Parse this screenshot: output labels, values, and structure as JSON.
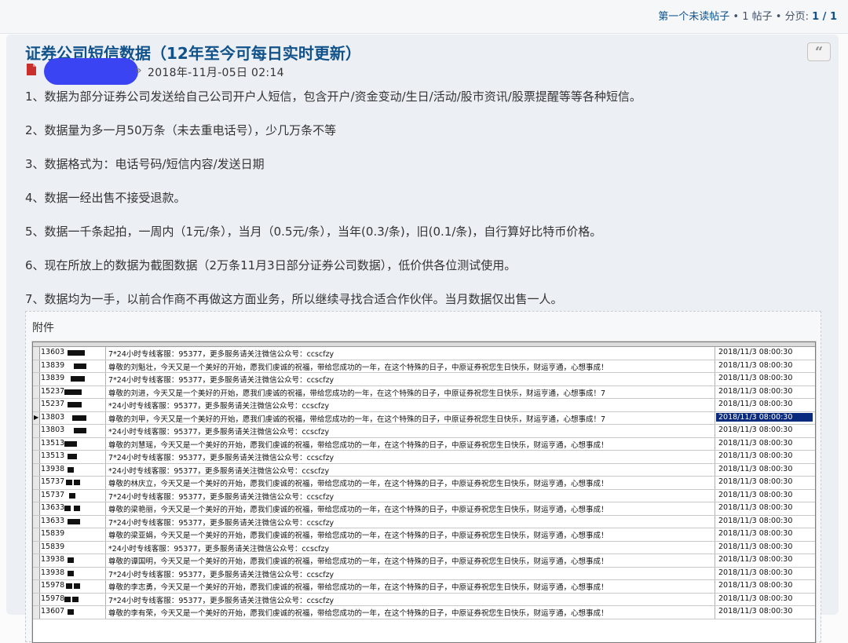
{
  "topbar": {
    "first_unread": "第一个未读帖子",
    "sep1": "•",
    "post_count": "1 帖子",
    "sep2": "•",
    "page_label": "分页:",
    "pages": "1 / 1"
  },
  "post": {
    "title": "证券公司短信数据（12年至今可每日实时更新）",
    "quote_icon": "quote-icon",
    "author_sep": "»",
    "date": "2018年-11月-05日 02:14",
    "paragraphs": [
      "1、数据为部分证券公司发送给自己公司开户人短信，包含开户/资金变动/生日/活动/股市资讯/股票提醒等等各种短信。",
      "2、数据量为多一月50万条（未去重电话号），少几万条不等",
      "3、数据格式为：电话号码/短信内容/发送日期",
      "4、数据一经出售不接受退款。",
      "5、数据一千条起拍，一周内（1元/条），当月（0.5元/条），当年(0.3/条)，旧(0.1/条)，自行算好比特币价格。",
      "6、现在所放上的数据为截图数据（2万条11月3日部分证券公司数据），低价供各位测试使用。",
      "7、数据均为一手，以前合作商不再做这方面业务，所以继续寻找合适合作伙伴。当月数据仅出售一人。"
    ]
  },
  "attachment": {
    "label": "附件",
    "rows": [
      {
        "phone": "13603",
        "sms": "7*24小时专线客服：95377，更多服务请关注微信公众号：ccscfzy",
        "date": "2018/11/3 08:00:30",
        "active": false
      },
      {
        "phone": "13839",
        "sms": "尊敬的刘魁壮，今天又是一个美好的开始，愿我们虔诚的祝福，带给您成功的一年，在这个特殊的日子，中原证券祝您生日快乐，财运亨通，心想事成！",
        "date": "2018/11/3 08:00:30",
        "active": false
      },
      {
        "phone": "13839",
        "sms": "7*24小时专线客服：95377，更多服务请关注微信公众号：ccscfzy",
        "date": "2018/11/3 08:00:30",
        "active": false
      },
      {
        "phone": "15237",
        "sms": "尊敬的刘进，今天又是一个美好的开始，愿我们虔诚的祝福，带给您成功的一年，在这个特殊的日子，中原证券祝您生日快乐，财运亨通，心想事成！7",
        "date": "2018/11/3 08:00:30",
        "active": false
      },
      {
        "phone": "15237",
        "sms": "*24小时专线客服：95377，更多服务请关注微信公众号：ccscfzy",
        "date": "2018/11/3 08:00:30",
        "active": false
      },
      {
        "phone": "13803",
        "sms": "尊敬的刘甲，今天又是一个美好的开始，愿我们虔诚的祝福，带给您成功的一年，在这个特殊的日子，中原证券祝您生日快乐，财运亨通，心想事成！7",
        "date": "2018/11/3 08:00:30",
        "active": true
      },
      {
        "phone": "13803",
        "sms": "*24小时专线客服：95377，更多服务请关注微信公众号：ccscfzy",
        "date": "2018/11/3 08:00:30",
        "active": false
      },
      {
        "phone": "13513",
        "sms": "尊敬的刘慧瑶，今天又是一个美好的开始，愿我们虔诚的祝福，带给您成功的一年，在这个特殊的日子，中原证券祝您生日快乐，财运亨通，心想事成！",
        "date": "2018/11/3 08:00:30",
        "active": false
      },
      {
        "phone": "13513",
        "sms": "7*24小时专线客服：95377，更多服务请关注微信公众号：ccscfzy",
        "date": "2018/11/3 08:00:30",
        "active": false
      },
      {
        "phone": "13938",
        "sms": "*24小时专线客服：95377，更多服务请关注微信公众号：ccscfzy",
        "date": "2018/11/3 08:00:30",
        "active": false
      },
      {
        "phone": "15737",
        "sms": "尊敬的林庆立，今天又是一个美好的开始，愿我们虔诚的祝福，带给您成功的一年，在这个特殊的日子，中原证券祝您生日快乐，财运亨通，心想事成！",
        "date": "2018/11/3 08:00:30",
        "active": false
      },
      {
        "phone": "15737",
        "sms": "7*24小时专线客服：95377，更多服务请关注微信公众号：ccscfzy",
        "date": "2018/11/3 08:00:30",
        "active": false
      },
      {
        "phone": "13633",
        "sms": "尊敬的梁艳丽，今天又是一个美好的开始，愿我们虔诚的祝福，带给您成功的一年，在这个特殊的日子，中原证券祝您生日快乐，财运亨通，心想事成！",
        "date": "2018/11/3 08:00:30",
        "active": false
      },
      {
        "phone": "13633",
        "sms": "7*24小时专线客服：95377，更多服务请关注微信公众号：ccscfzy",
        "date": "2018/11/3 08:00:30",
        "active": false
      },
      {
        "phone": "15839",
        "sms": "尊敬的梁亚娟，今天又是一个美好的开始，愿我们虔诚的祝福，带给您成功的一年，在这个特殊的日子，中原证券祝您生日快乐，财运亨通，心想事成！",
        "date": "2018/11/3 08:00:30",
        "active": false
      },
      {
        "phone": "15839",
        "sms": "*24小时专线客服：95377，更多服务请关注微信公众号：ccscfzy",
        "date": "2018/11/3 08:00:30",
        "active": false
      },
      {
        "phone": "13938",
        "sms": "尊敬的谭国明，今天又是一个美好的开始，愿我们虔诚的祝福，带给您成功的一年，在这个特殊的日子，中原证券祝您生日快乐，财运亨通，心想事成！",
        "date": "2018/11/3 08:00:30",
        "active": false
      },
      {
        "phone": "13938",
        "sms": "7*24小时专线客服：95377，更多服务请关注微信公众号：ccscfzy",
        "date": "2018/11/3 08:00:30",
        "active": false
      },
      {
        "phone": "15978",
        "sms": "尊敬的李志勇，今天又是一个美好的开始，愿我们虔诚的祝福，带给您成功的一年，在这个特殊的日子，中原证券祝您生日快乐，财运亨通，心想事成！",
        "date": "2018/11/3 08:00:30",
        "active": false
      },
      {
        "phone": "15978",
        "sms": "7*24小时专线客服：95377，更多服务请关注微信公众号：ccscfzy",
        "date": "2018/11/3 08:00:30",
        "active": false
      },
      {
        "phone": "13607",
        "sms": "尊敬的李有荣，今天又是一个美好的开始，愿我们虔诚的祝福，带给您成功的一年，在这个特殊的日子，中原证券祝您生日快乐，财运亨通，心想事成！",
        "date": "2018/11/3 08:00:30",
        "active": false
      }
    ]
  },
  "colors": {
    "link": "#105289",
    "post_bg": "#ecf0f5",
    "redaction": "#3a44f2",
    "selected_cell": "#0a2a7e"
  }
}
